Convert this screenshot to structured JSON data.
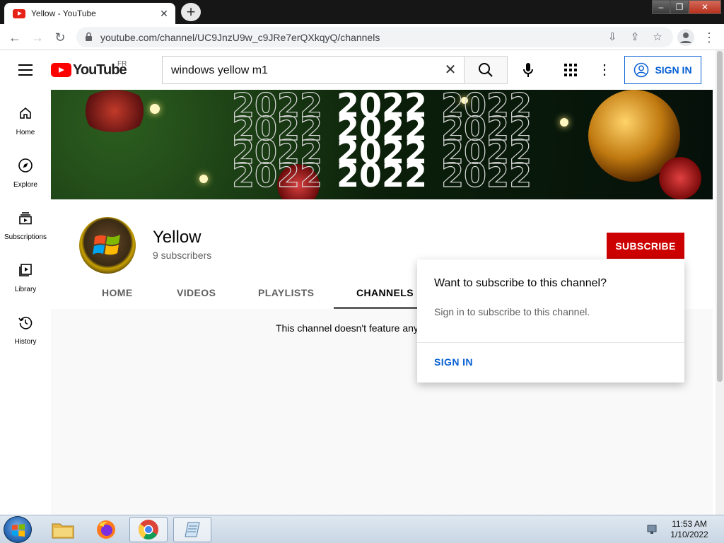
{
  "browser": {
    "tab_title": "Yellow - YouTube",
    "url": "youtube.com/channel/UC9JnzU9w_c9JRe7erQXkqyQ/channels"
  },
  "header": {
    "logo_text": "YouTube",
    "country_code": "FR",
    "search_value": "windows yellow m1",
    "sign_in_label": "SIGN IN"
  },
  "sidebar": {
    "items": [
      {
        "label": "Home"
      },
      {
        "label": "Explore"
      },
      {
        "label": "Subscriptions"
      },
      {
        "label": "Library"
      },
      {
        "label": "History"
      }
    ]
  },
  "banner": {
    "year_text": "2022"
  },
  "channel": {
    "name": "Yellow",
    "subscribers": "9 subscribers",
    "subscribe_label": "SUBSCRIBE",
    "tabs": [
      {
        "label": "HOME"
      },
      {
        "label": "VIDEOS"
      },
      {
        "label": "PLAYLISTS"
      },
      {
        "label": "CHANNELS"
      }
    ],
    "empty_message": "This channel doesn't feature any"
  },
  "popup": {
    "title": "Want to subscribe to this channel?",
    "text": "Sign in to subscribe to this channel.",
    "sign_in_label": "SIGN IN"
  },
  "taskbar": {
    "time": "11:53 AM",
    "date": "1/10/2022"
  },
  "colors": {
    "subscribe": "#cc0000",
    "link_blue": "#065fd4",
    "youtube_red": "#ff0000"
  }
}
